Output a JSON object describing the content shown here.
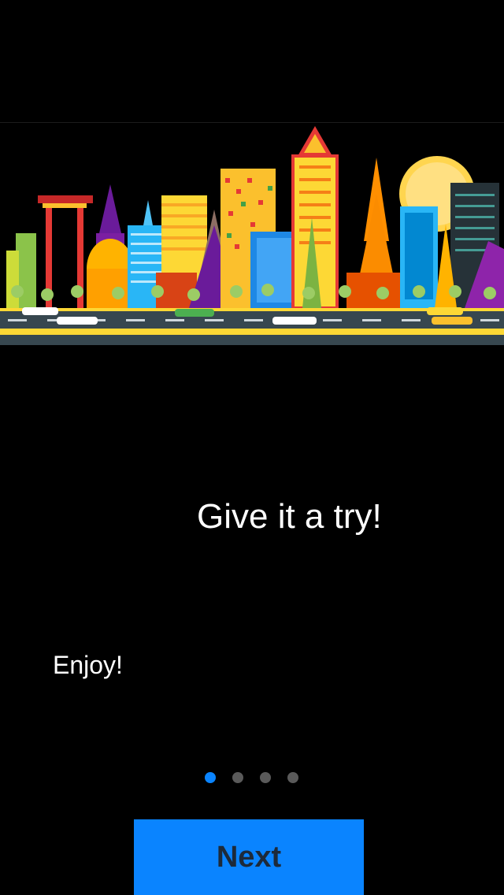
{
  "onboarding": {
    "illustration": "city-skyline-illustration",
    "headline": "Give it a try!",
    "subtext": "Enjoy!",
    "page_indicator": {
      "total": 4,
      "current": 1
    },
    "next_label": "Next"
  },
  "colors": {
    "background": "#000000",
    "accent": "#0a84ff",
    "button_text": "#1d2a3a",
    "dot_inactive": "#5a5a5a"
  }
}
